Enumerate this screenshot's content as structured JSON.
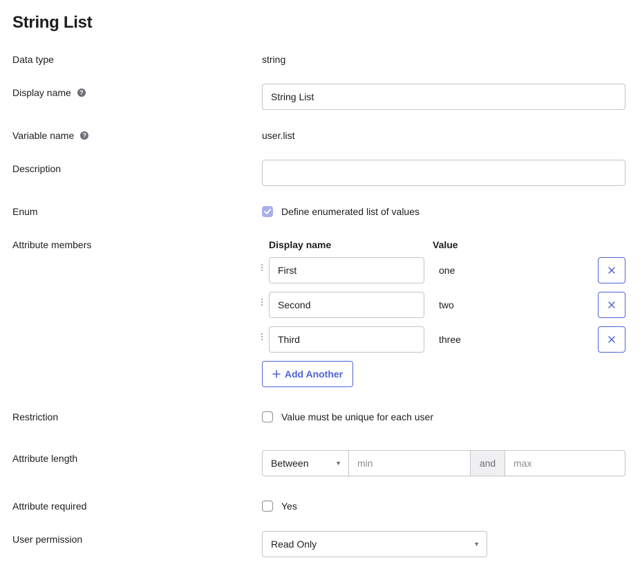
{
  "page_title": "String List",
  "fields": {
    "data_type": {
      "label": "Data type",
      "value": "string"
    },
    "display_name": {
      "label": "Display name",
      "value": "String List"
    },
    "variable_name": {
      "label": "Variable name",
      "value": "user.list"
    },
    "description": {
      "label": "Description",
      "value": ""
    },
    "enum": {
      "label": "Enum",
      "checkbox_label": "Define enumerated list of values",
      "checked": true
    },
    "attribute_members": {
      "label": "Attribute members",
      "col_display_name": "Display name",
      "col_value": "Value",
      "members": [
        {
          "display_name": "First",
          "value": "one"
        },
        {
          "display_name": "Second",
          "value": "two"
        },
        {
          "display_name": "Third",
          "value": "three"
        }
      ],
      "add_label": "Add Another"
    },
    "restriction": {
      "label": "Restriction",
      "checkbox_label": "Value must be unique for each user",
      "checked": false
    },
    "attribute_length": {
      "label": "Attribute length",
      "operator": "Between",
      "min_placeholder": "min",
      "and_label": "and",
      "max_placeholder": "max"
    },
    "attribute_required": {
      "label": "Attribute required",
      "checkbox_label": "Yes",
      "checked": false
    },
    "user_permission": {
      "label": "User permission",
      "value": "Read Only"
    }
  },
  "colors": {
    "accent": "#4c64d4",
    "checked_box": "#a7b0ee",
    "border": "#c4c5ca"
  },
  "icons": [
    "help-icon",
    "check-icon",
    "drag-handle-icon",
    "close-icon",
    "plus-icon",
    "chevron-down-icon"
  ]
}
